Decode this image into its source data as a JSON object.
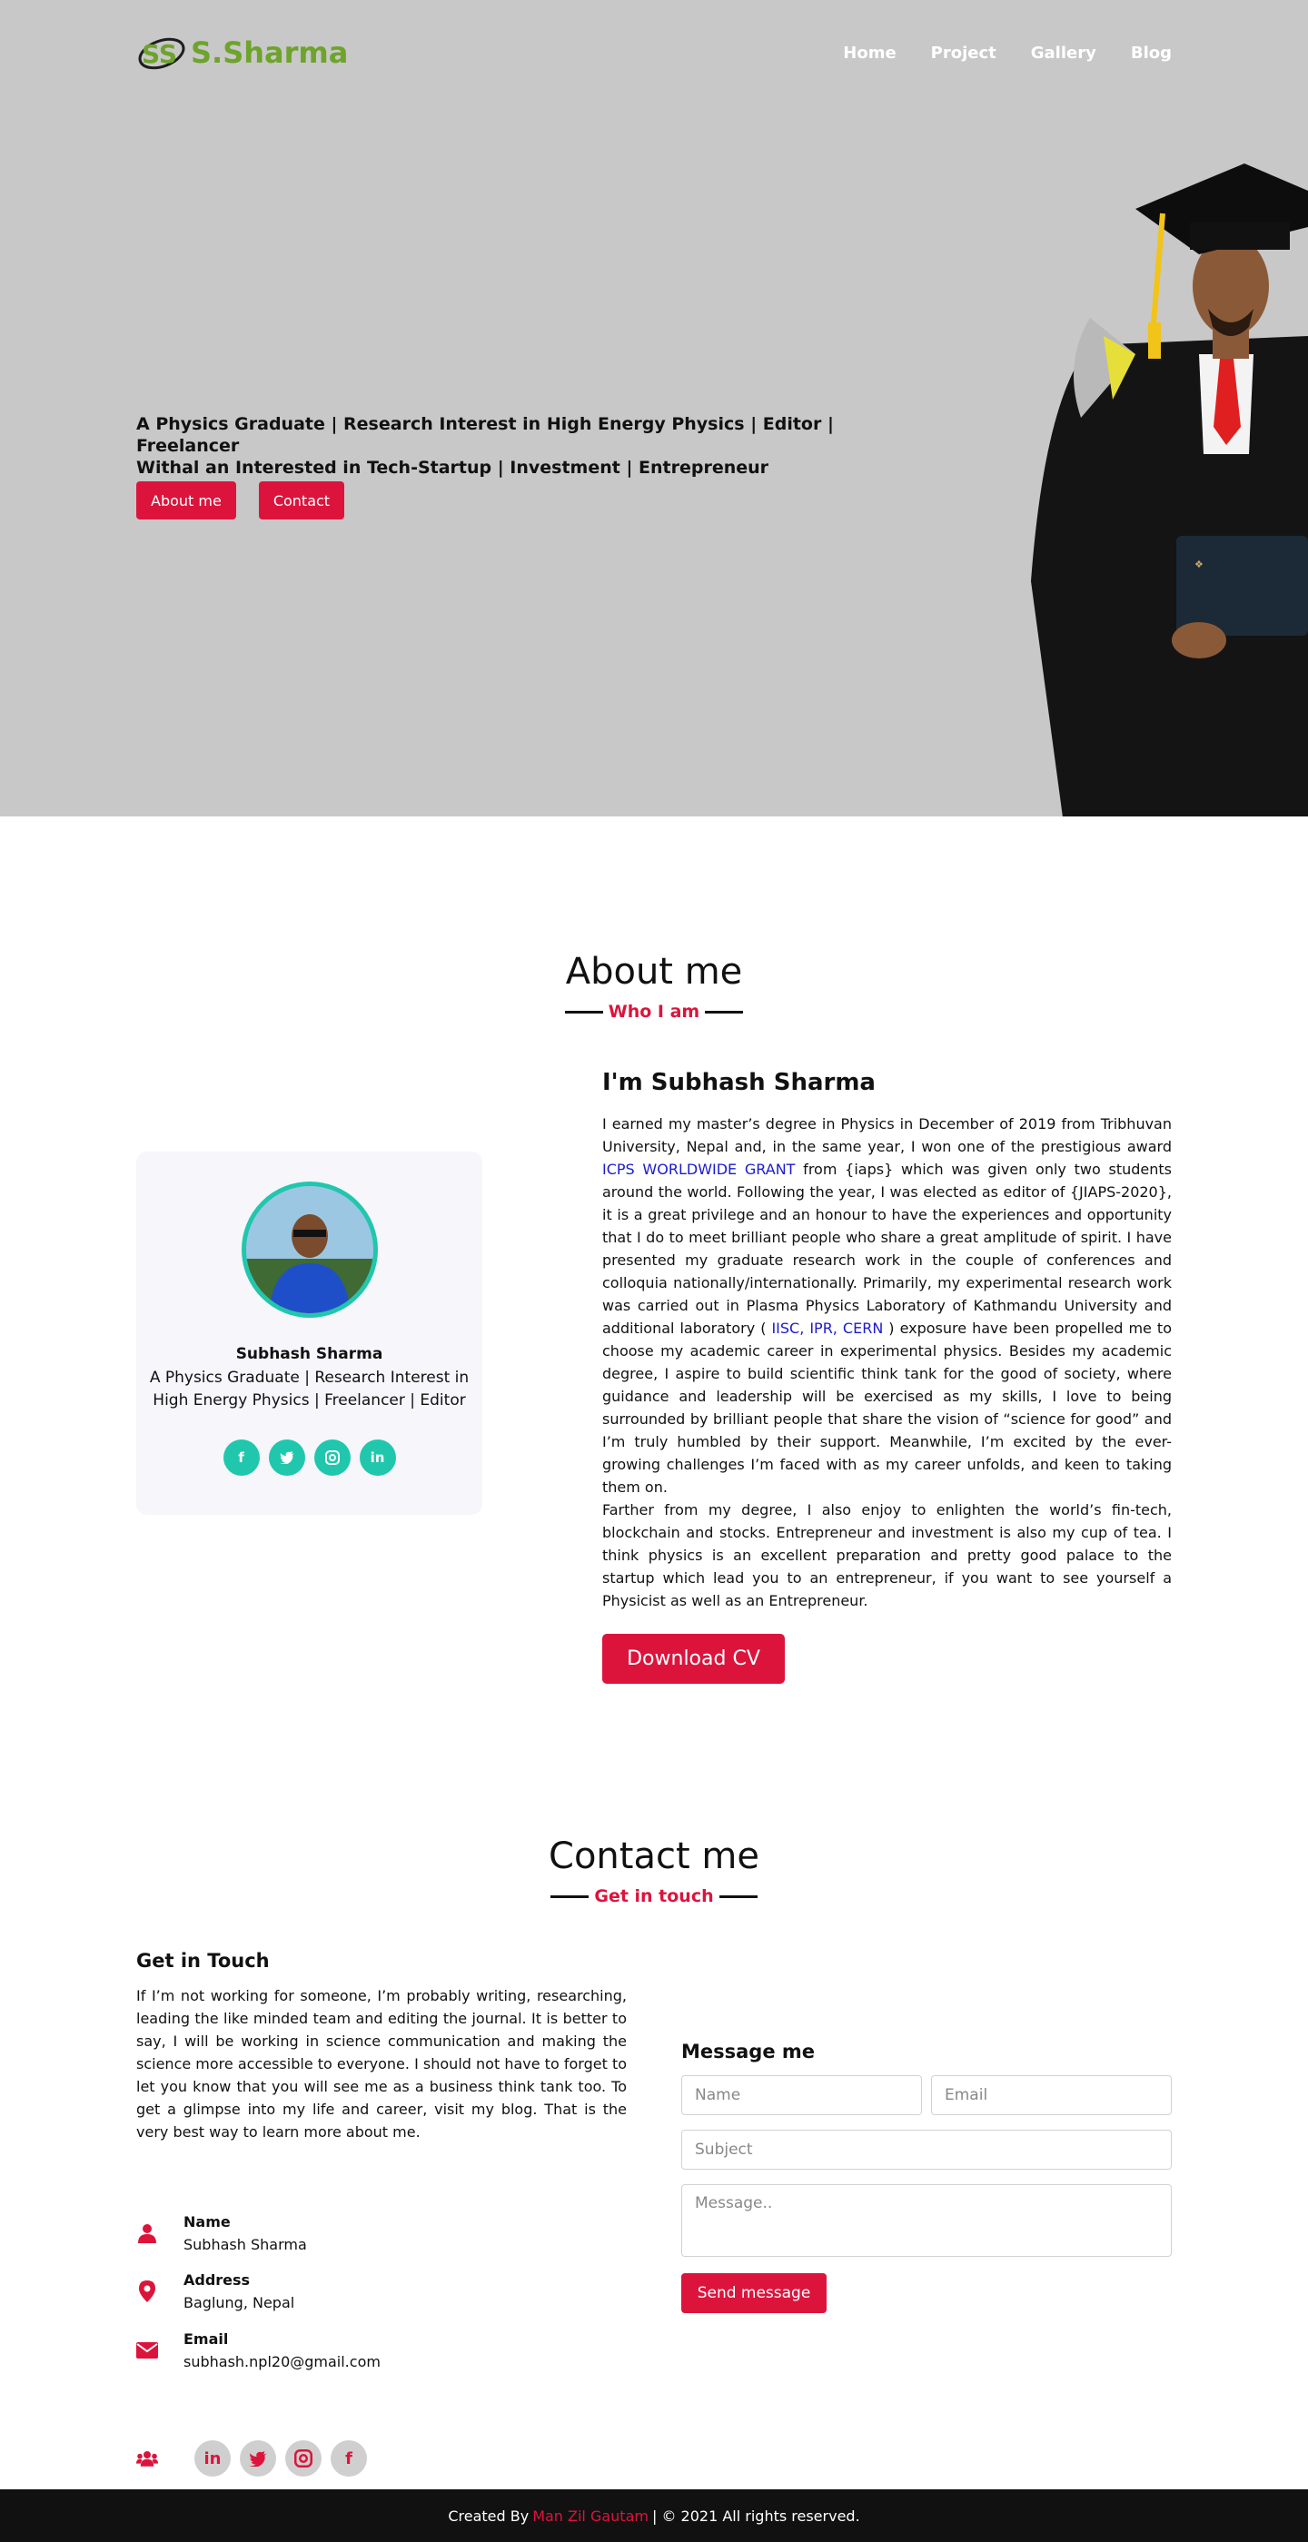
{
  "header": {
    "logo_text": "S.Sharma",
    "nav": [
      "Home",
      "Project",
      "Gallery",
      "Blog"
    ]
  },
  "hero": {
    "line1": "A Physics Graduate | Research Interest in High Energy Physics | Editor | Freelancer",
    "line2": "Withal an Interested in Tech-Startup | Investment | Entrepreneur",
    "about_btn": "About me",
    "contact_btn": "Contact"
  },
  "about": {
    "title": "About me",
    "subtitle": "Who I am",
    "card_name": "Subhash Sharma",
    "card_role": "A Physics Graduate | Research Interest in High Energy Physics | Freelancer | Editor",
    "socials": [
      "facebook-icon",
      "twitter-icon",
      "instagram-icon",
      "linkedin-icon"
    ],
    "heading": "I'm Subhash Sharma",
    "bio_p1_a": "I earned my master’s degree in Physics in December of 2019 from Tribhuvan University, Nepal and, in the same year, I won one of the prestigious award ",
    "bio_p1_link1": "ICPS WORLDWIDE GRANT",
    "bio_p1_b": " from {iaps} which was given only two students around the world. Following the year, I was elected as editor of {JIAPS-2020}, it is a great privilege and an honour to have the experiences and opportunity that I do to meet brilliant people who share a great amplitude of spirit. I have presented my graduate research work in the couple of conferences and colloquia nationally/internationally. Primarily, my experimental research work was carried out in Plasma Physics Laboratory of Kathmandu University and additional laboratory ( ",
    "bio_p1_link2": "IISC, IPR, CERN",
    "bio_p1_c": " ) exposure have been propelled me to choose my academic career in experimental physics. Besides my academic degree, I aspire to build scientific think tank for the good of society, where guidance and leadership will be exercised as my skills, I love to being surrounded by brilliant people that share the vision of “science for good” and I’m truly humbled by their support. Meanwhile, I’m excited by the ever-growing challenges I’m faced with as my career unfolds, and keen to taking them on.",
    "bio_p2": "Farther from my degree, I also enjoy to enlighten the world’s fin-tech, blockchain and stocks. Entrepreneur and investment is also my cup of tea. I think physics is an excellent preparation and pretty good palace to the startup which lead you to an entrepreneur, if you want to see yourself a Physicist as well as an Entrepreneur.",
    "cv_btn": "Download CV"
  },
  "contact": {
    "title": "Contact me",
    "subtitle": "Get in touch",
    "get_in_touch_title": "Get in Touch",
    "get_in_touch_text": "If I’m not working for someone, I’m probably writing, researching, leading the like minded team and editing the journal. It is better to say, I will be working in science communication and making the science more accessible to everyone. I should not have to forget to let you know that you will see me as a business think tank too. To get a glimpse into my life and career, visit my blog. That is the very best way to learn more about me.",
    "name_label": "Name",
    "name_value": "Subhash Sharma",
    "address_label": "Address",
    "address_value": "Baglung, Nepal",
    "email_label": "Email",
    "email_value": "subhash.npl20@gmail.com",
    "socials": [
      "linkedin-icon",
      "twitter-icon",
      "instagram-icon",
      "facebook-icon"
    ],
    "form_title": "Message me",
    "placeholder_name": "Name",
    "placeholder_email": "Email",
    "placeholder_subject": "Subject",
    "placeholder_message": "Message..",
    "send_btn": "Send message"
  },
  "footer": {
    "prefix": "Created By",
    "author": "Man Zil Gautam",
    "suffix": "| © 2021 All rights reserved."
  },
  "colors": {
    "accent": "#dc143c",
    "teal": "#20c7ad",
    "logo_green": "#6ea32c",
    "hero_bg": "#c8c8c8"
  }
}
